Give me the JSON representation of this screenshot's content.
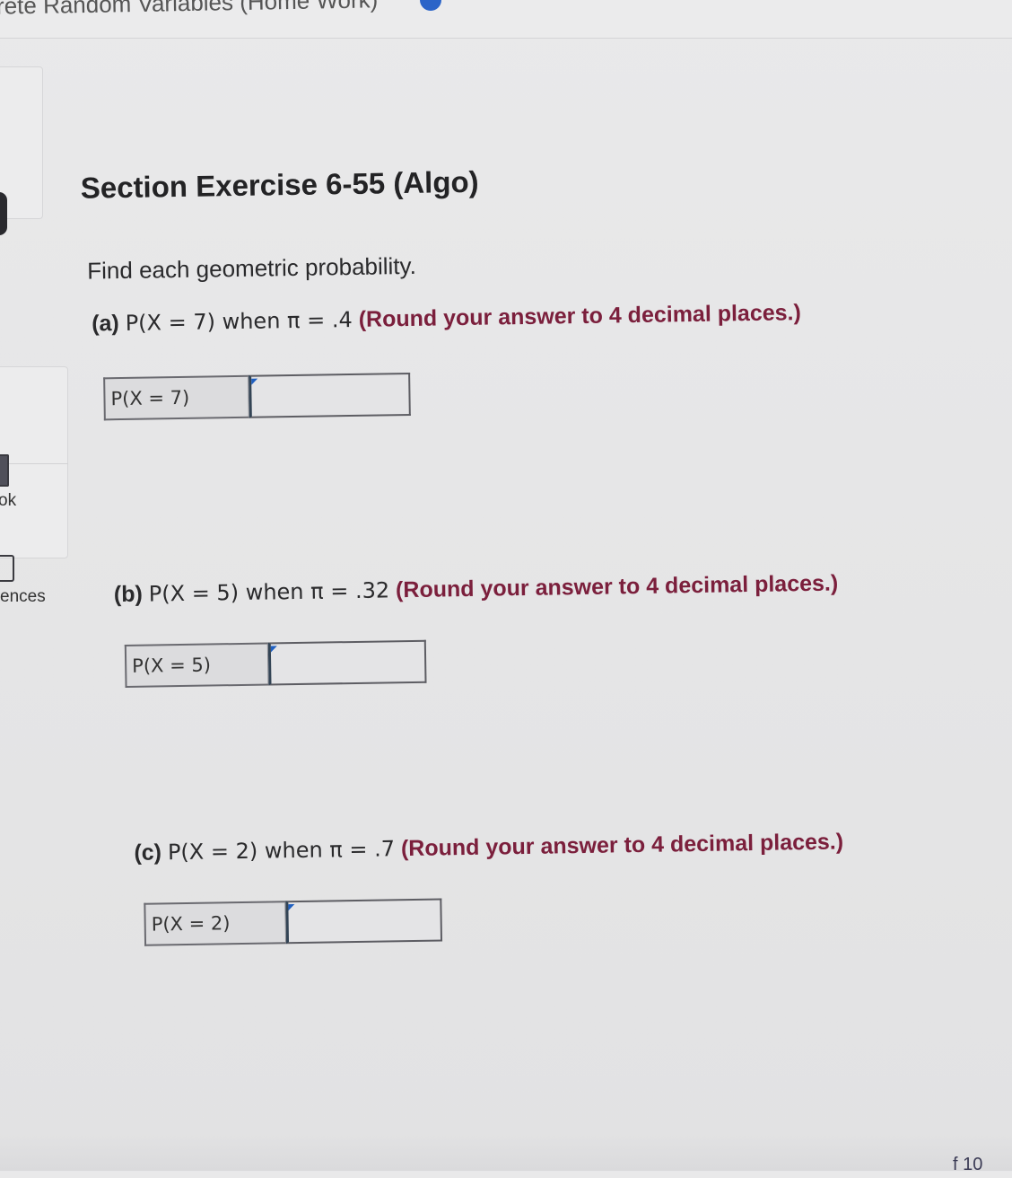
{
  "window": {
    "title": "rete Random Variables (Home Work)"
  },
  "sidebar": {
    "items": [
      {
        "label": "ok"
      },
      {
        "label": "ences"
      }
    ]
  },
  "exercise": {
    "title": "Section Exercise 6-55 (Algo)",
    "prompt": "Find each geometric probability.",
    "questions": [
      {
        "part": "(a)",
        "expression": "P(X = 7) when π = .4",
        "note": "(Round your answer to 4 decimal places.)",
        "answer_label": "P(X = 7)",
        "answer_value": ""
      },
      {
        "part": "(b)",
        "expression": "P(X = 5) when π = .32",
        "note": "(Round your answer to 4 decimal places.)",
        "answer_label": "P(X = 5)",
        "answer_value": ""
      },
      {
        "part": "(c)",
        "expression": "P(X = 2) when π = .7",
        "note": "(Round your answer to 4 decimal places.)",
        "answer_label": "P(X = 2)",
        "answer_value": ""
      }
    ]
  },
  "footer": {
    "page_indicator": "f 10"
  },
  "colors": {
    "note_text": "#7b1f3c",
    "accent": "#2b64c8"
  }
}
